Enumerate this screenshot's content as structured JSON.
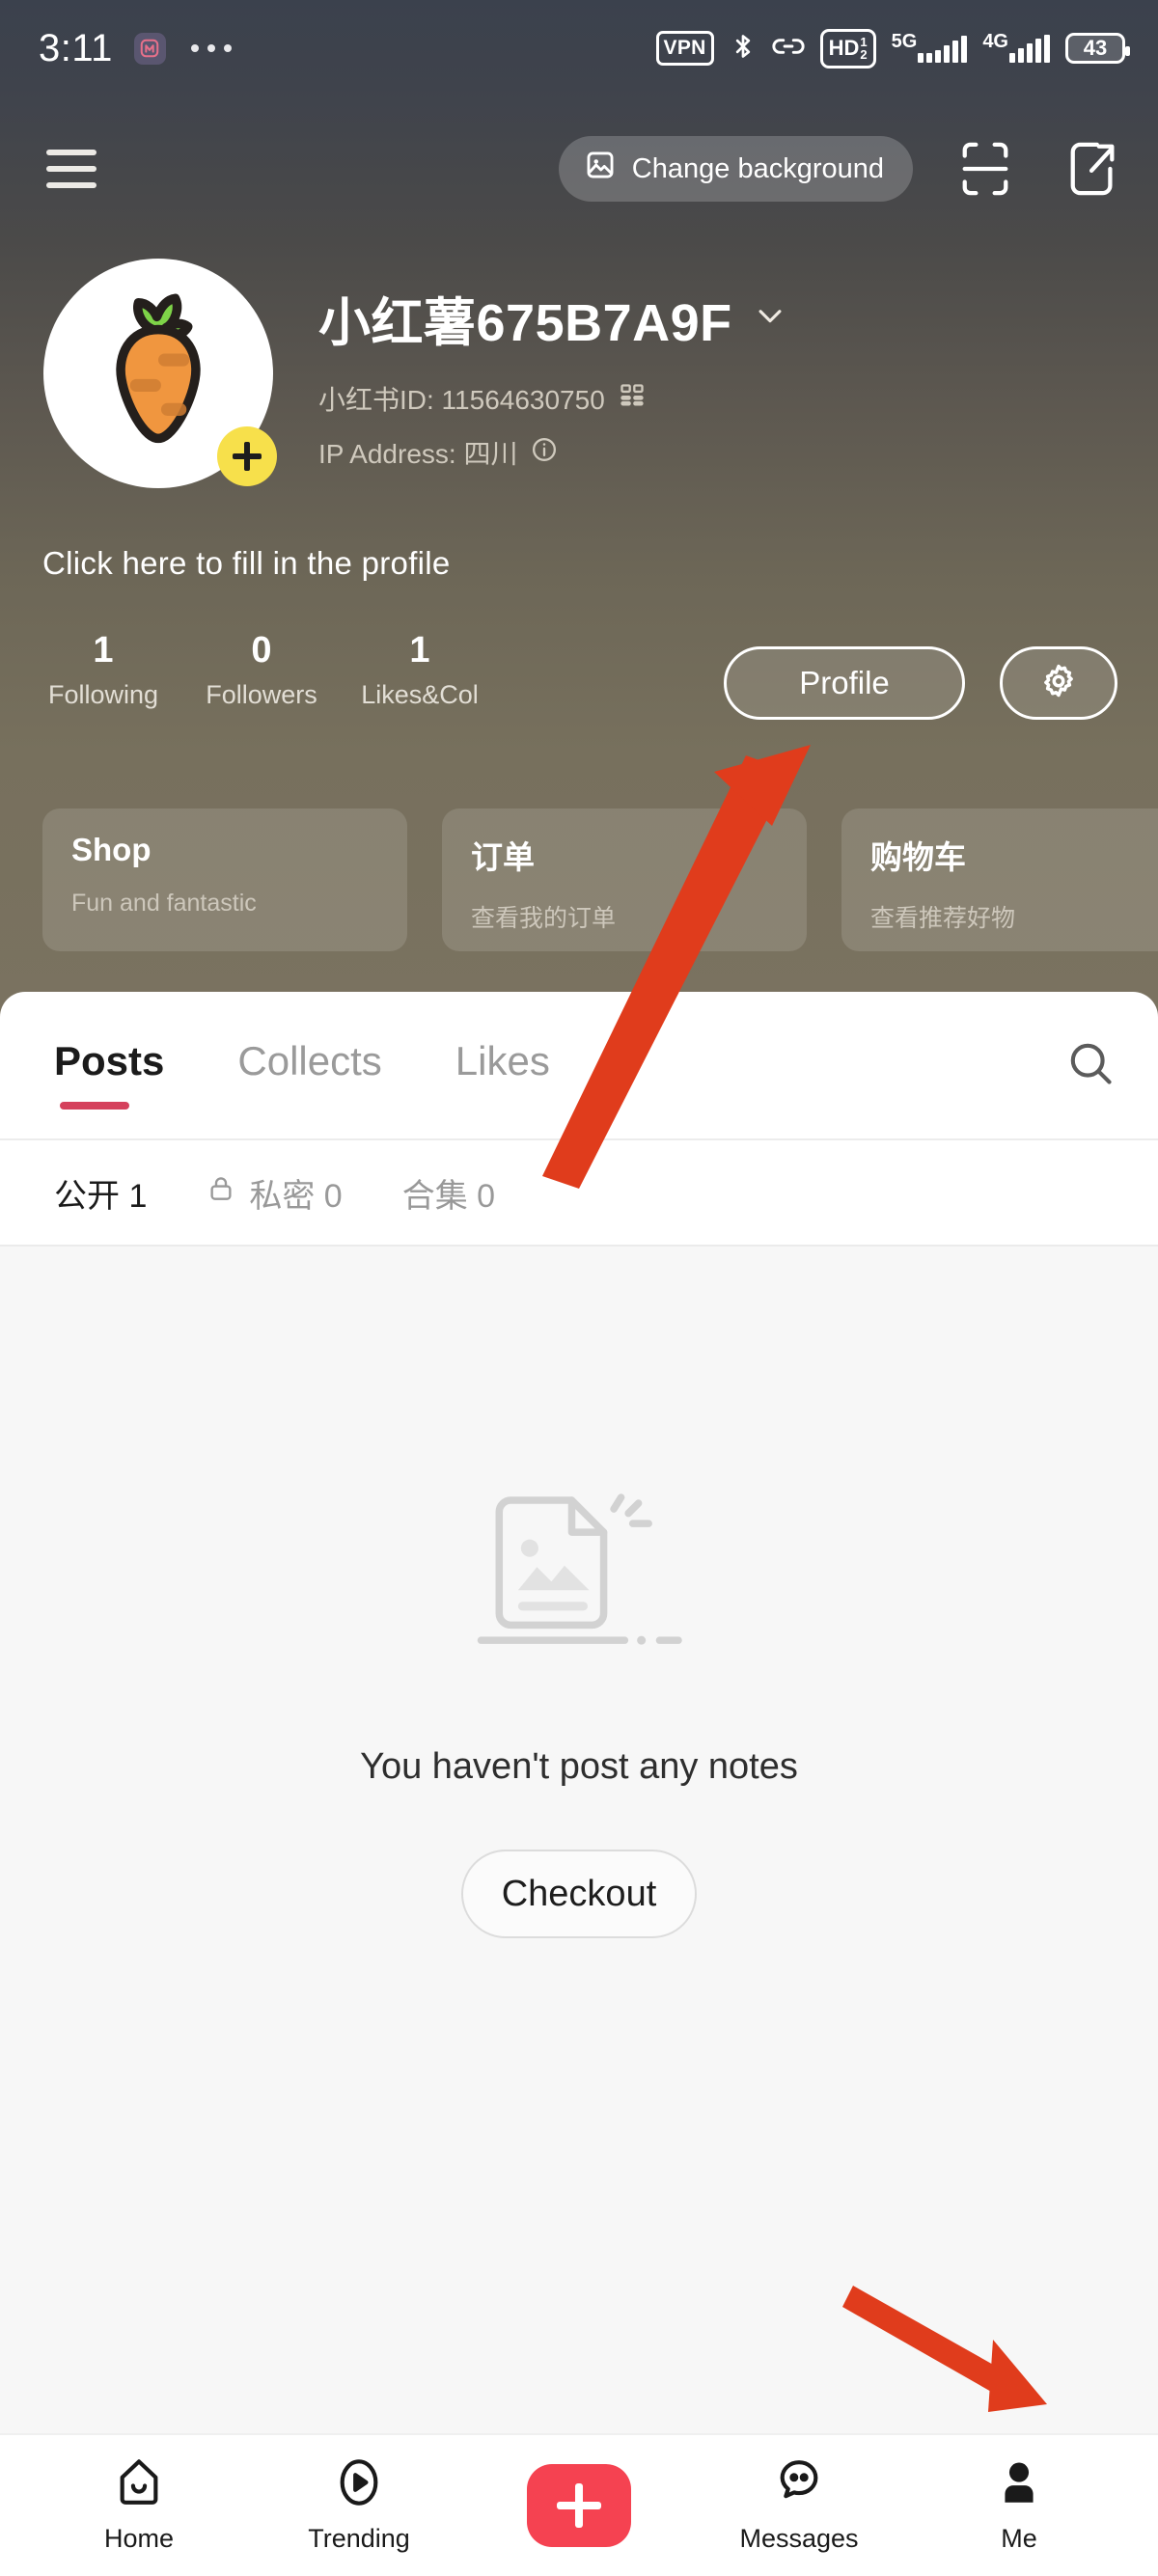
{
  "status_bar": {
    "time": "3:11",
    "app_badge_icon": "app-badge-icon",
    "overflow_dots": "...",
    "vpn_label": "VPN",
    "bluetooth_icon": "bluetooth-icon",
    "link_icon": "link-icon",
    "hd_label": "HD",
    "hd_sim_top": "1",
    "hd_sim_bottom": "2",
    "network_1": "5G",
    "network_2": "4G",
    "battery_percent": "43"
  },
  "top_bar": {
    "menu_icon": "hamburger-menu-icon",
    "change_background_label": "Change background",
    "change_background_icon": "image-icon",
    "scan_icon": "scan-icon",
    "share_icon": "share-external-icon"
  },
  "profile": {
    "avatar_icon": "carrot-avatar",
    "avatar_add_icon": "plus-icon",
    "username": "小红薯675B7A9F",
    "name_dropdown_icon": "chevron-down-icon",
    "id_label": "小红书ID: 11564630750",
    "qr_icon": "qr-code-icon",
    "ip_label": "IP Address: 四川",
    "info_icon": "info-circle-icon",
    "tagline": "Click here to fill in the profile",
    "stats": [
      {
        "value": "1",
        "label": "Following"
      },
      {
        "value": "0",
        "label": "Followers"
      },
      {
        "value": "1",
        "label": "Likes&Col"
      }
    ],
    "profile_button": "Profile",
    "settings_icon": "gear-icon"
  },
  "shop_cards": [
    {
      "title": "Shop",
      "subtitle": "Fun and fantastic"
    },
    {
      "title": "订单",
      "subtitle": "查看我的订单"
    },
    {
      "title": "购物车",
      "subtitle": "查看推荐好物"
    },
    {
      "title": "",
      "subtitle": ""
    }
  ],
  "content_tabs": {
    "items": [
      {
        "label": "Posts",
        "active": true
      },
      {
        "label": "Collects",
        "active": false
      },
      {
        "label": "Likes",
        "active": false
      }
    ],
    "search_icon": "search-icon"
  },
  "sub_tabs": [
    {
      "label": "公开 1",
      "icon": "",
      "active": true
    },
    {
      "label": "私密 0",
      "icon": "lock-icon",
      "active": false
    },
    {
      "label": "合集 0",
      "icon": "",
      "active": false
    }
  ],
  "empty_state": {
    "illustration_icon": "empty-notes-illustration",
    "message": "You haven't post any notes",
    "button_label": "Checkout"
  },
  "bottom_nav": [
    {
      "label": "Home",
      "icon": "home-icon"
    },
    {
      "label": "Trending",
      "icon": "play-circle-icon"
    },
    {
      "label": "",
      "icon": "plus-create-icon"
    },
    {
      "label": "Messages",
      "icon": "chat-bubble-icon"
    },
    {
      "label": "Me",
      "icon": "person-icon"
    }
  ],
  "annotations": {
    "arrow_color": "#e03c1c",
    "arrow_1_target": "profile-button",
    "arrow_2_target": "me-nav-item"
  },
  "colors": {
    "hero_top": "#3b414d",
    "hero_bottom": "#7a7260",
    "accent_red": "#d5415c",
    "create_red": "#f54251",
    "avatar_badge_yellow": "#f7e04b",
    "content_bg": "#f7f7f7"
  }
}
